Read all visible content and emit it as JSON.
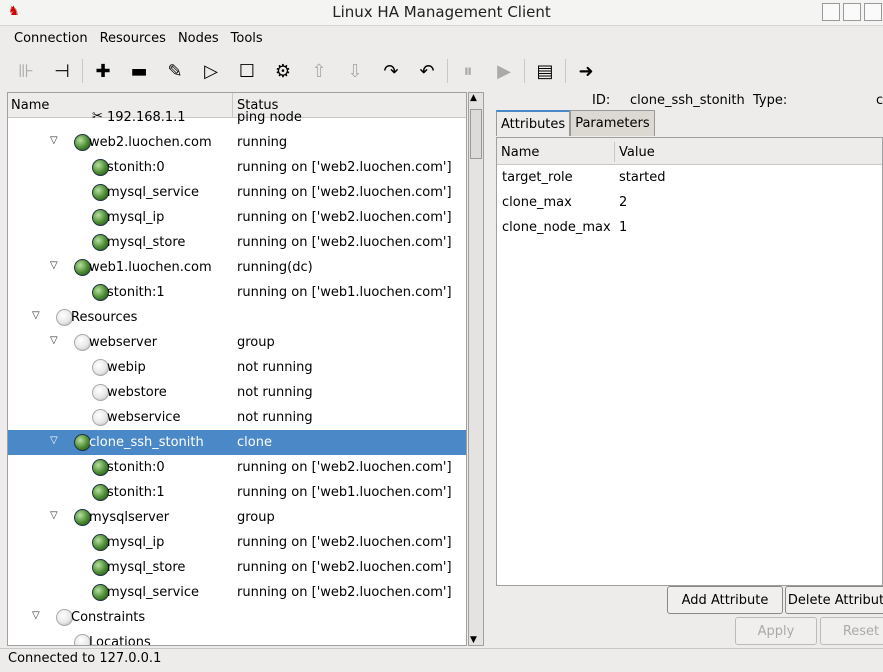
{
  "window": {
    "title": "Linux HA Management Client"
  },
  "menu": [
    "Connection",
    "Resources",
    "Nodes",
    "Tools"
  ],
  "toolbar": [
    {
      "icon": "connect-icon",
      "glyph": "⊪",
      "disabled": true
    },
    {
      "icon": "disconnect-icon",
      "glyph": "⊣",
      "disabled": false
    },
    {
      "sep": true
    },
    {
      "icon": "add-icon",
      "glyph": "✚",
      "disabled": false
    },
    {
      "icon": "remove-icon",
      "glyph": "▬",
      "disabled": false
    },
    {
      "icon": "cleanup-broom-icon",
      "glyph": "✎",
      "disabled": false
    },
    {
      "icon": "start-icon",
      "glyph": "▷",
      "disabled": false
    },
    {
      "icon": "stop-icon",
      "glyph": "☐",
      "disabled": false
    },
    {
      "icon": "gears-icon",
      "glyph": "⚙",
      "disabled": false
    },
    {
      "icon": "move-up-icon",
      "glyph": "⇧",
      "disabled": true
    },
    {
      "icon": "move-down-icon",
      "glyph": "⇩",
      "disabled": true
    },
    {
      "icon": "redo-icon",
      "glyph": "↷",
      "disabled": false
    },
    {
      "icon": "undo-icon",
      "glyph": "↶",
      "disabled": false
    },
    {
      "sep": true
    },
    {
      "icon": "standby-icon",
      "glyph": "⏸",
      "disabled": true
    },
    {
      "icon": "active-icon",
      "glyph": "▶",
      "disabled": true
    },
    {
      "sep": true
    },
    {
      "icon": "document-icon",
      "glyph": "▤",
      "disabled": false
    },
    {
      "sep": true
    },
    {
      "icon": "exit-icon",
      "glyph": "➜",
      "disabled": false
    }
  ],
  "tree": {
    "columns": [
      "Name",
      "Status"
    ],
    "rows": [
      {
        "level": 3,
        "icon": "tool",
        "name": "192.168.1.1",
        "status": "ping node"
      },
      {
        "level": 2,
        "exp": true,
        "icon": "green",
        "name": "web2.luochen.com",
        "status": "running"
      },
      {
        "level": 3,
        "icon": "green",
        "name": "stonith:0",
        "status": "running on ['web2.luochen.com']"
      },
      {
        "level": 3,
        "icon": "green",
        "name": "mysql_service",
        "status": "running on ['web2.luochen.com']"
      },
      {
        "level": 3,
        "icon": "green",
        "name": "mysql_ip",
        "status": "running on ['web2.luochen.com']"
      },
      {
        "level": 3,
        "icon": "green",
        "name": "mysql_store",
        "status": "running on ['web2.luochen.com']"
      },
      {
        "level": 2,
        "exp": true,
        "icon": "green",
        "name": "web1.luochen.com",
        "status": "running(dc)"
      },
      {
        "level": 3,
        "icon": "green",
        "name": "stonith:1",
        "status": "running on ['web1.luochen.com']"
      },
      {
        "level": 1,
        "exp": true,
        "icon": "bulb",
        "name": "Resources",
        "status": ""
      },
      {
        "level": 2,
        "exp": true,
        "icon": "bulb",
        "name": "webserver",
        "status": "group"
      },
      {
        "level": 3,
        "icon": "bulb",
        "name": "webip",
        "status": "not running"
      },
      {
        "level": 3,
        "icon": "bulb",
        "name": "webstore",
        "status": "not running"
      },
      {
        "level": 3,
        "icon": "bulb",
        "name": "webservice",
        "status": "not running"
      },
      {
        "level": 2,
        "exp": true,
        "icon": "green",
        "name": "clone_ssh_stonith",
        "status": "clone",
        "selected": true
      },
      {
        "level": 3,
        "icon": "green",
        "name": "stonith:0",
        "status": "running on ['web2.luochen.com']"
      },
      {
        "level": 3,
        "icon": "green",
        "name": "stonith:1",
        "status": "running on ['web1.luochen.com']"
      },
      {
        "level": 2,
        "exp": true,
        "icon": "green",
        "name": "mysqlserver",
        "status": "group"
      },
      {
        "level": 3,
        "icon": "green",
        "name": "mysql_ip",
        "status": "running on ['web2.luochen.com']"
      },
      {
        "level": 3,
        "icon": "green",
        "name": "mysql_store",
        "status": "running on ['web2.luochen.com']"
      },
      {
        "level": 3,
        "icon": "green",
        "name": "mysql_service",
        "status": "running on ['web2.luochen.com']"
      },
      {
        "level": 1,
        "exp": true,
        "icon": "bulb",
        "name": "Constraints",
        "status": ""
      },
      {
        "level": 2,
        "icon": "bulb",
        "name": "Locations",
        "status": ""
      }
    ]
  },
  "detail": {
    "id_label": "ID:",
    "id_value": "clone_ssh_stonith",
    "type_label": "Type:",
    "type_value": "c",
    "tabs": [
      "Attributes",
      "Parameters"
    ],
    "columns": [
      "Name",
      "Value"
    ],
    "attributes": [
      [
        "target_role",
        "started"
      ],
      [
        "clone_max",
        "2"
      ],
      [
        "clone_node_max",
        "1"
      ]
    ],
    "add_attribute": "Add Attribute",
    "delete_attribute": "Delete Attribute",
    "apply": "Apply",
    "reset": "Reset"
  },
  "status": "Connected to 127.0.0.1",
  "colors": {
    "selection": "#4a88c8",
    "logo": "#cc0000"
  }
}
